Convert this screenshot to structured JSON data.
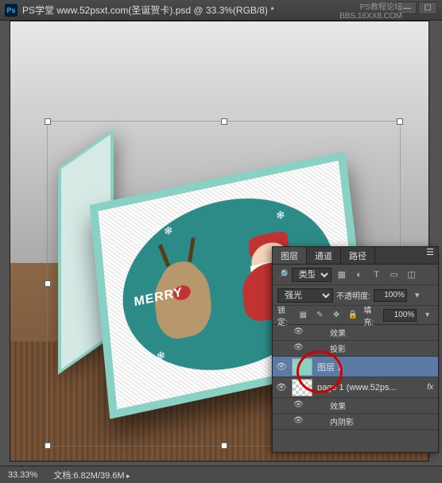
{
  "titlebar": {
    "app_icon": "Ps",
    "title": "PS学堂  www.52psxt.com(圣诞贺卡).psd @ 33.3%(RGB/8) *"
  },
  "watermark": {
    "line1": "PS教程论坛",
    "line2": "BBS.16XX8.COM"
  },
  "card": {
    "merry_text": "MERRY"
  },
  "panel": {
    "tabs": {
      "layers": "图层",
      "channels": "通道",
      "paths": "路径"
    },
    "filter_kind": "类型",
    "blend_mode": "强光",
    "opacity_label": "不透明度:",
    "opacity_value": "100%",
    "lock_label": "锁定:",
    "fill_label": "填充:",
    "fill_value": "100%",
    "layers": {
      "fx_label": "效果",
      "drop_shadow": "投影",
      "layer1": "图层 1",
      "page1": "page 1 (www.52ps...",
      "page1_fx_suffix": "fx",
      "inner_shadow": "内阴影"
    }
  },
  "statusbar": {
    "zoom": "33.33%",
    "doc_label": "文档:",
    "doc_value": "6.82M/39.6M"
  }
}
